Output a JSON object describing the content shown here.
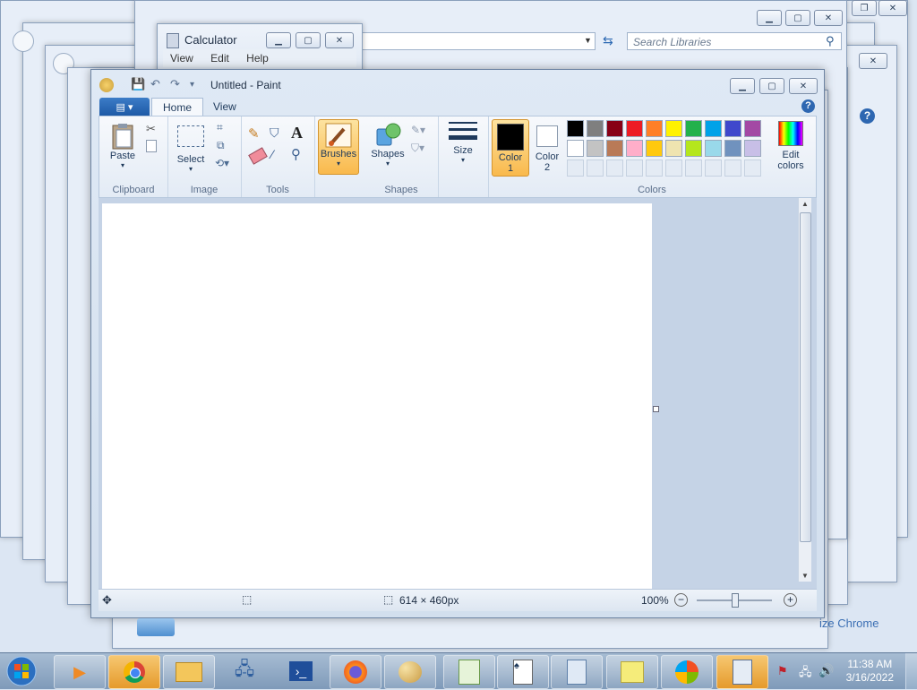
{
  "background_windows": {
    "search_placeholder": "Search Libraries",
    "chrome_button": "ize Chrome"
  },
  "calculator": {
    "title": "Calculator",
    "menu": [
      "View",
      "Edit",
      "Help"
    ]
  },
  "paint": {
    "title": "Untitled - Paint",
    "tabs": [
      "Home",
      "View"
    ],
    "groups": {
      "clipboard": {
        "label": "Clipboard",
        "paste": "Paste"
      },
      "image": {
        "label": "Image",
        "select": "Select"
      },
      "tools": {
        "label": "Tools"
      },
      "brushes": {
        "label": "Brushes"
      },
      "shapes": {
        "label": "Shapes",
        "shapes_btn": "Shapes"
      },
      "size": {
        "label": "Size"
      },
      "colors": {
        "label": "Colors",
        "color1": "Color\n1",
        "color1_a": "Color",
        "color1_b": "1",
        "color2_a": "Color",
        "color2_b": "2",
        "edit_a": "Edit",
        "edit_b": "colors"
      }
    },
    "palette_row1": [
      "#000000",
      "#7f7f7f",
      "#880015",
      "#ed1c24",
      "#ff7f27",
      "#fff200",
      "#22b14c",
      "#00a2e8",
      "#3f48cc",
      "#a349a4"
    ],
    "palette_row2": [
      "#ffffff",
      "#c3c3c3",
      "#b97a57",
      "#ffaec9",
      "#ffc90e",
      "#efe4b0",
      "#b5e61d",
      "#99d9ea",
      "#7092be",
      "#c8bfe7"
    ],
    "color1": "#000000",
    "color2": "#ffffff",
    "status": {
      "size": "614 × 460px",
      "zoom": "100%"
    }
  },
  "taskbar": {
    "time": "11:38 AM",
    "date": "3/16/2022"
  }
}
